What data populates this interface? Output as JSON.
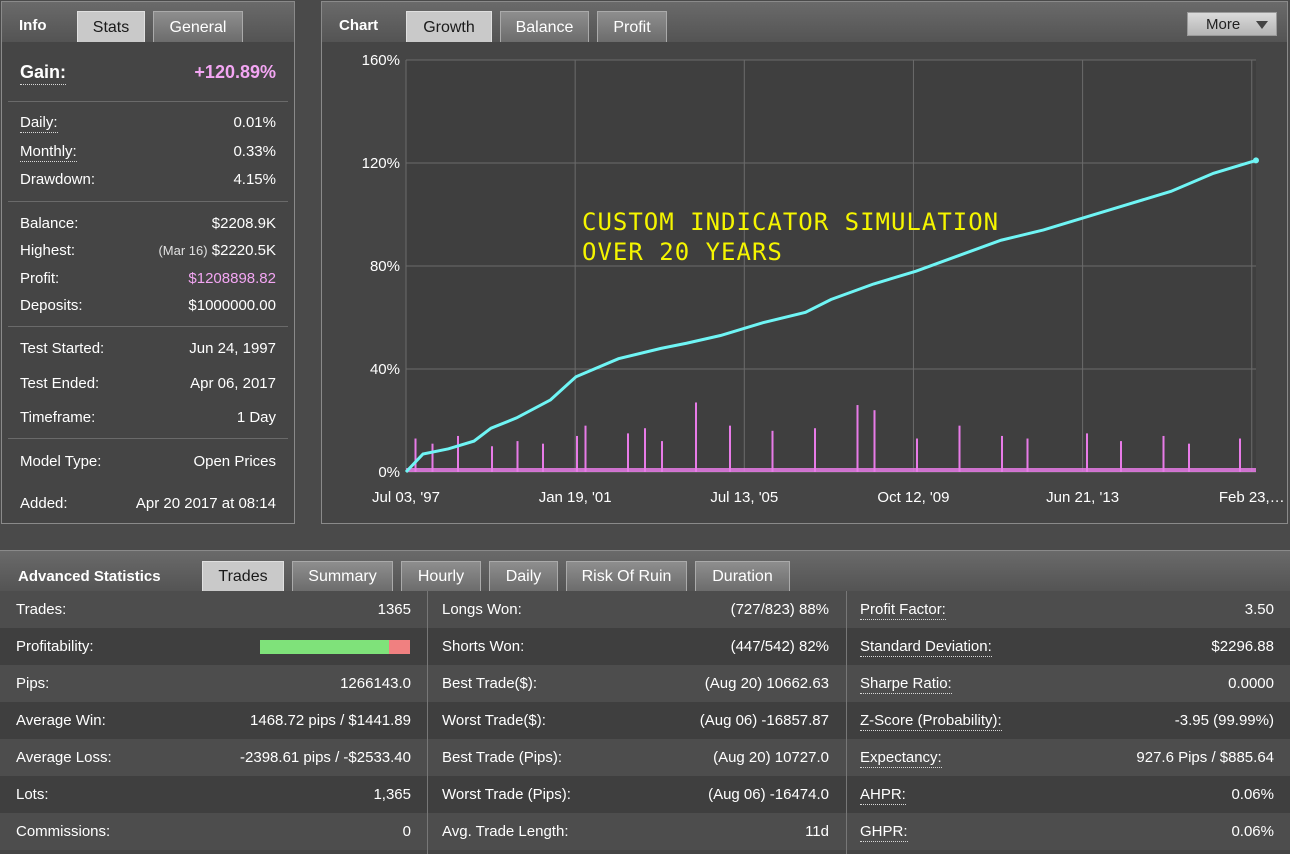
{
  "info": {
    "tabs": [
      {
        "label": "Info",
        "active": false
      },
      {
        "label": "Stats",
        "active": true
      },
      {
        "label": "General",
        "active": false
      }
    ],
    "gain": {
      "label": "Gain:",
      "value": "+120.89%"
    },
    "daily": {
      "label": "Daily:",
      "value": "0.01%"
    },
    "monthly": {
      "label": "Monthly:",
      "value": "0.33%"
    },
    "drawdown": {
      "label": "Drawdown:",
      "value": "4.15%"
    },
    "balance": {
      "label": "Balance:",
      "value": "$2208.9K"
    },
    "highest": {
      "label": "Highest:",
      "date": "(Mar 16)",
      "value": "$2220.5K"
    },
    "profit": {
      "label": "Profit:",
      "value": "$1208898.82"
    },
    "deposits": {
      "label": "Deposits:",
      "value": "$1000000.00"
    },
    "test_started": {
      "label": "Test Started:",
      "value": "Jun 24, 1997"
    },
    "test_ended": {
      "label": "Test Ended:",
      "value": "Apr 06, 2017"
    },
    "timeframe": {
      "label": "Timeframe:",
      "value": "1 Day"
    },
    "model_type": {
      "label": "Model Type:",
      "value": "Open Prices"
    },
    "added": {
      "label": "Added:",
      "value": "Apr 20 2017 at 08:14"
    }
  },
  "chart_panel": {
    "title": "Chart",
    "tabs": [
      {
        "label": "Growth",
        "active": true
      },
      {
        "label": "Balance",
        "active": false
      },
      {
        "label": "Profit",
        "active": false
      }
    ],
    "more_label": "More",
    "annotation_line1": "CUSTOM INDICATOR SIMULATION",
    "annotation_line2": "OVER 20 YEARS"
  },
  "chart_data": {
    "type": "line",
    "title": "",
    "xlabel": "",
    "ylabel": "",
    "x_tick_labels": [
      "Jul 03, '97",
      "Jan 19, '01",
      "Jul 13, '05",
      "Oct 12, '09",
      "Jun 21, '13",
      "Feb 23,…"
    ],
    "y_tick_labels": [
      "0%",
      "40%",
      "80%",
      "120%",
      "160%"
    ],
    "ylim": [
      0,
      160
    ],
    "grid": true,
    "colors": {
      "growth": "#6ff5f5",
      "trades": "#e87be8",
      "annotation": "#f5f500"
    },
    "series": [
      {
        "type": "line",
        "x": [
          0,
          0.02,
          0.05,
          0.08,
          0.1,
          0.13,
          0.17,
          0.2,
          0.25,
          0.3,
          0.33,
          0.37,
          0.42,
          0.47,
          0.5,
          0.55,
          0.6,
          0.65,
          0.7,
          0.75,
          0.8,
          0.85,
          0.9,
          0.95,
          1.0
        ],
        "values": [
          0,
          7,
          9,
          12,
          17,
          21,
          28,
          37,
          44,
          48,
          50,
          53,
          58,
          62,
          67,
          73,
          78,
          84,
          90,
          94,
          99,
          104,
          109,
          116,
          121
        ]
      },
      {
        "type": "bar",
        "x": [
          0.01,
          0.03,
          0.06,
          0.1,
          0.13,
          0.16,
          0.2,
          0.21,
          0.26,
          0.28,
          0.3,
          0.34,
          0.38,
          0.43,
          0.48,
          0.53,
          0.55,
          0.6,
          0.65,
          0.7,
          0.73,
          0.8,
          0.84,
          0.89,
          0.92,
          0.98
        ],
        "values": [
          13,
          11,
          14,
          10,
          12,
          11,
          14,
          18,
          15,
          17,
          12,
          27,
          18,
          16,
          17,
          26,
          24,
          13,
          18,
          14,
          13,
          15,
          12,
          14,
          11,
          13
        ]
      }
    ]
  },
  "advanced": {
    "title": "Advanced Statistics",
    "tabs": [
      {
        "label": "Trades",
        "active": true
      },
      {
        "label": "Summary",
        "active": false
      },
      {
        "label": "Hourly",
        "active": false
      },
      {
        "label": "Daily",
        "active": false
      },
      {
        "label": "Risk Of Ruin",
        "active": false
      },
      {
        "label": "Duration",
        "active": false
      }
    ],
    "profitability_won_fraction": 0.86,
    "rows": [
      {
        "c1_label": "Trades:",
        "c1_value": "1365",
        "c2_label": "Longs Won:",
        "c2_value": "(727/823) 88%",
        "c3_label": "Profit Factor:",
        "c3_value": "3.50"
      },
      {
        "c1_label": "Profitability:",
        "c1_value": "",
        "c2_label": "Shorts Won:",
        "c2_value": "(447/542) 82%",
        "c3_label": "Standard Deviation:",
        "c3_value": "$2296.88"
      },
      {
        "c1_label": "Pips:",
        "c1_value": "1266143.0",
        "c2_label": "Best Trade($):",
        "c2_value": "(Aug 20) 10662.63",
        "c3_label": "Sharpe Ratio:",
        "c3_value": "0.0000"
      },
      {
        "c1_label": "Average Win:",
        "c1_value": "1468.72 pips / $1441.89",
        "c2_label": "Worst Trade($):",
        "c2_value": "(Aug 06) -16857.87",
        "c3_label": "Z-Score (Probability):",
        "c3_value": "-3.95 (99.99%)"
      },
      {
        "c1_label": "Average Loss:",
        "c1_value": "-2398.61 pips / -$2533.40",
        "c2_label": "Best Trade (Pips):",
        "c2_value": "(Aug 20) 10727.0",
        "c3_label": "Expectancy:",
        "c3_value": "927.6 Pips / $885.64"
      },
      {
        "c1_label": "Lots:",
        "c1_value": "1,365",
        "c2_label": "Worst Trade (Pips):",
        "c2_value": "(Aug 06) -16474.0",
        "c3_label": "AHPR:",
        "c3_value": "0.06%"
      },
      {
        "c1_label": "Commissions:",
        "c1_value": "0",
        "c2_label": "Avg. Trade Length:",
        "c2_value": "11d",
        "c3_label": "GHPR:",
        "c3_value": "0.06%"
      }
    ]
  }
}
